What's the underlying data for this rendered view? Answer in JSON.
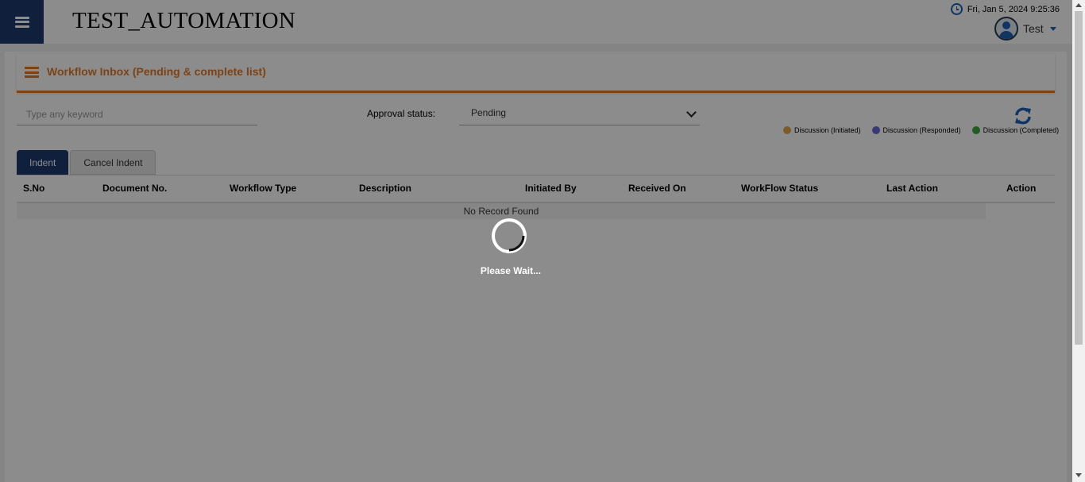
{
  "header": {
    "app_title": "TEST_AUTOMATION",
    "datetime": "Fri, Jan 5, 2024 9:25:36",
    "user_name": "Test"
  },
  "page": {
    "title": "Workflow Inbox (Pending & complete list)",
    "search_placeholder": "Type any keyword",
    "approval_label": "Approval status:",
    "approval_value": "Pending"
  },
  "legend": [
    {
      "label": "Discussion (Initiated)",
      "color": "#e3a64b"
    },
    {
      "label": "Discussion (Responded)",
      "color": "#6a66d6"
    },
    {
      "label": "Discussion (Completed)",
      "color": "#3fa646"
    }
  ],
  "tabs": [
    {
      "label": "Indent",
      "active": true
    },
    {
      "label": "Cancel Indent",
      "active": false
    }
  ],
  "table": {
    "columns": [
      "S.No",
      "Document No.",
      "Workflow Type",
      "Description",
      "Initiated By",
      "Received On",
      "WorkFlow Status",
      "Last Action",
      "Action"
    ],
    "empty_message": "No Record Found"
  },
  "loading": {
    "message": "Please Wait..."
  },
  "colors": {
    "primary": "#1e3a6e",
    "accent": "#e07a2c",
    "icon_blue": "#1d62b7"
  }
}
